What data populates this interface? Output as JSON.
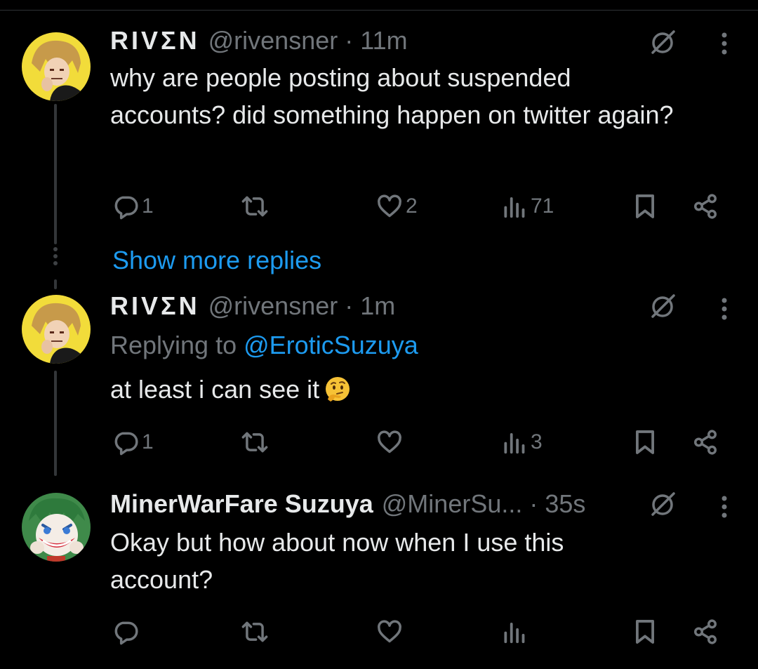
{
  "tweets": [
    {
      "name": "RIVΣN",
      "handle": "@rivensner",
      "separator": "·",
      "time": "11m",
      "text": "why are people posting about suspended accounts? did something happen on twitter again?",
      "replies": "1",
      "retweets": "",
      "likes": "2",
      "views": "71"
    },
    {
      "name": "RIVΣN",
      "handle": "@rivensner",
      "separator": "·",
      "time": "1m",
      "replying_prefix": "Replying to",
      "replying_to": "@EroticSuzuya",
      "text": "at least i can see it",
      "emoji": "thinking-face",
      "replies": "1",
      "retweets": "",
      "likes": "",
      "views": "3"
    },
    {
      "name": "MinerWarFare Suzuya",
      "handle": "@MinerSu...",
      "separator": "·",
      "time": "35s",
      "text": "Okay but how about now when I use this account?",
      "replies": "",
      "retweets": "",
      "likes": "",
      "views": ""
    }
  ],
  "show_more_replies": "Show more replies",
  "colors": {
    "background": "#000000",
    "text": "#e7e9ea",
    "muted": "#71767b",
    "accent": "#1d9bf0",
    "thread_line": "#333639"
  },
  "icons": [
    "reply-icon",
    "retweet-icon",
    "like-icon",
    "views-icon",
    "bookmark-icon",
    "share-icon",
    "grok-slash-icon",
    "more-vertical-icon"
  ]
}
